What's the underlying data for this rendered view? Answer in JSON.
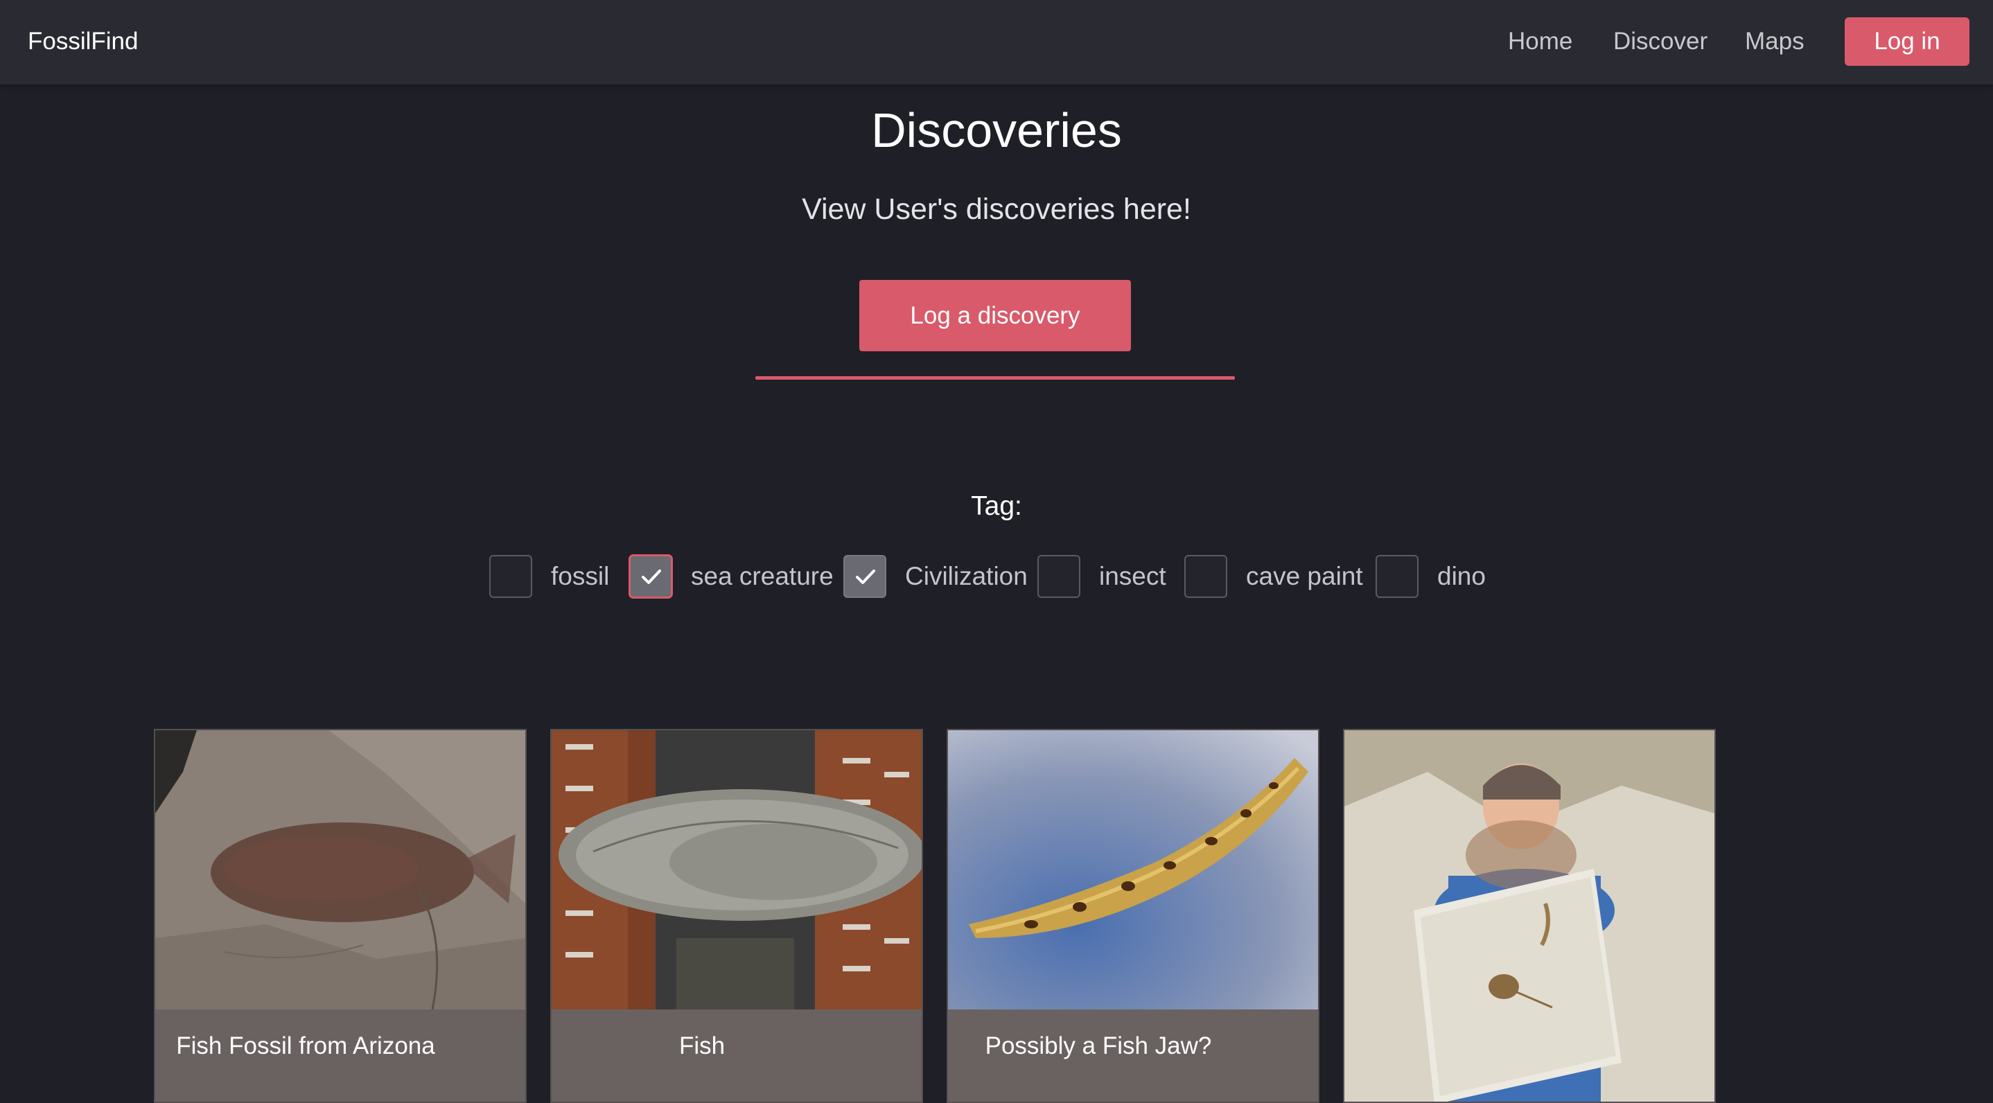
{
  "navbar": {
    "brand": "FossilFind",
    "links": [
      "Home",
      "Discover",
      "Maps"
    ],
    "login_label": "Log in"
  },
  "hero": {
    "title": "Discoveries",
    "subtitle": "View User's discoveries here!",
    "log_button_label": "Log a discovery"
  },
  "filter": {
    "label": "Tag:",
    "tags": [
      {
        "label": "fossil",
        "checked": false
      },
      {
        "label": "sea creature",
        "checked": true
      },
      {
        "label": "Civilization",
        "checked": true
      },
      {
        "label": "insect",
        "checked": false
      },
      {
        "label": "cave paint",
        "checked": false
      },
      {
        "label": "dino",
        "checked": false
      }
    ]
  },
  "cards": [
    {
      "title": "Fish Fossil from Arizona"
    },
    {
      "title": "Fish"
    },
    {
      "title": "Possibly a Fish Jaw?"
    },
    {
      "title": ""
    }
  ],
  "colors": {
    "accent": "#d95a6a",
    "background": "#1f1f27",
    "navbar": "#2a2a32",
    "card": "#6a6261"
  }
}
